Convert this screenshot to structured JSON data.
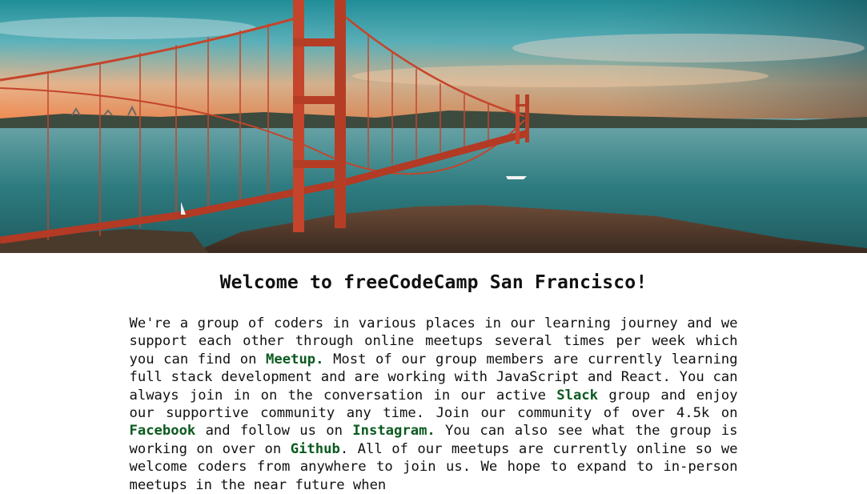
{
  "hero": {
    "image": "golden-gate-bridge-photo"
  },
  "heading": "Welcome to freeCodeCamp San Francisco!",
  "intro": {
    "seg1": "We're a group of coders in various places in our learning journey and we support each other through online meetups several times per week which you can find on ",
    "link_meetup": "Meetup.",
    "seg2": " Most of our group members are currently learning full stack development and are working with JavaScript and React. You can always join in on the conversation in our active ",
    "link_slack": "Slack",
    "seg3": " group and enjoy our supportive community any time. Join our community of over 4.5k on ",
    "link_facebook": "Facebook",
    "seg4": " and follow us on ",
    "link_instagram": "Instagram.",
    "seg5": " You can also see what the group is working on over on ",
    "link_github": "Github",
    "seg6": ". All of our meetups are currently online so we welcome coders from anywhere to join us. We hope to expand to in-person meetups in the near future when"
  },
  "colors": {
    "link": "#0b5a1f",
    "bridge": "#c4452b"
  }
}
